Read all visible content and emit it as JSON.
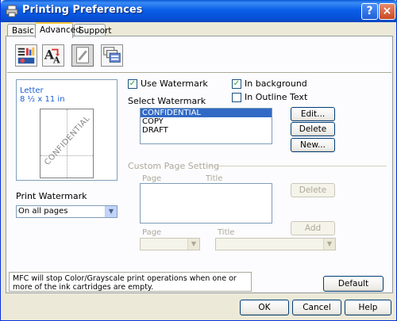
{
  "window": {
    "title": "Printing Preferences",
    "help_label": "?",
    "close_label": "×"
  },
  "tabs": [
    {
      "label": "Basic"
    },
    {
      "label": "Advanced"
    },
    {
      "label": "Support"
    }
  ],
  "toolbar": [
    "color-quality-icon",
    "font-scaling-icon",
    "watermark-icon",
    "device-options-icon"
  ],
  "preview": {
    "paper_name": "Letter",
    "paper_size": "8 ½ x 11 in",
    "watermark_text": "CONFIDENTIAL"
  },
  "watermark": {
    "use_label": "Use Watermark",
    "use_checked": true,
    "background_label": "In background",
    "background_checked": true,
    "outline_label": "In Outline Text",
    "outline_checked": false,
    "select_label": "Select Watermark",
    "items": [
      "CONFIDENTIAL",
      "COPY",
      "DRAFT"
    ],
    "selected_index": 0,
    "edit_label": "Edit...",
    "delete_label": "Delete",
    "new_label": "New..."
  },
  "print_watermark": {
    "label": "Print Watermark",
    "value": "On all pages"
  },
  "custom_page": {
    "heading": "Custom Page Setting",
    "page_col": "Page",
    "title_col": "Title",
    "delete_label": "Delete",
    "add_label": "Add",
    "page_field_label": "Page",
    "title_field_label": "Title"
  },
  "notice": "MFC will stop Color/Grayscale print operations when one or more of the ink cartridges are empty.",
  "buttons": {
    "default": "Default",
    "ok": "OK",
    "cancel": "Cancel",
    "help": "Help"
  },
  "colors": {
    "titlebar": "#0a5ad6",
    "accent_tab": "#ffc83c",
    "selection": "#316ac5"
  }
}
